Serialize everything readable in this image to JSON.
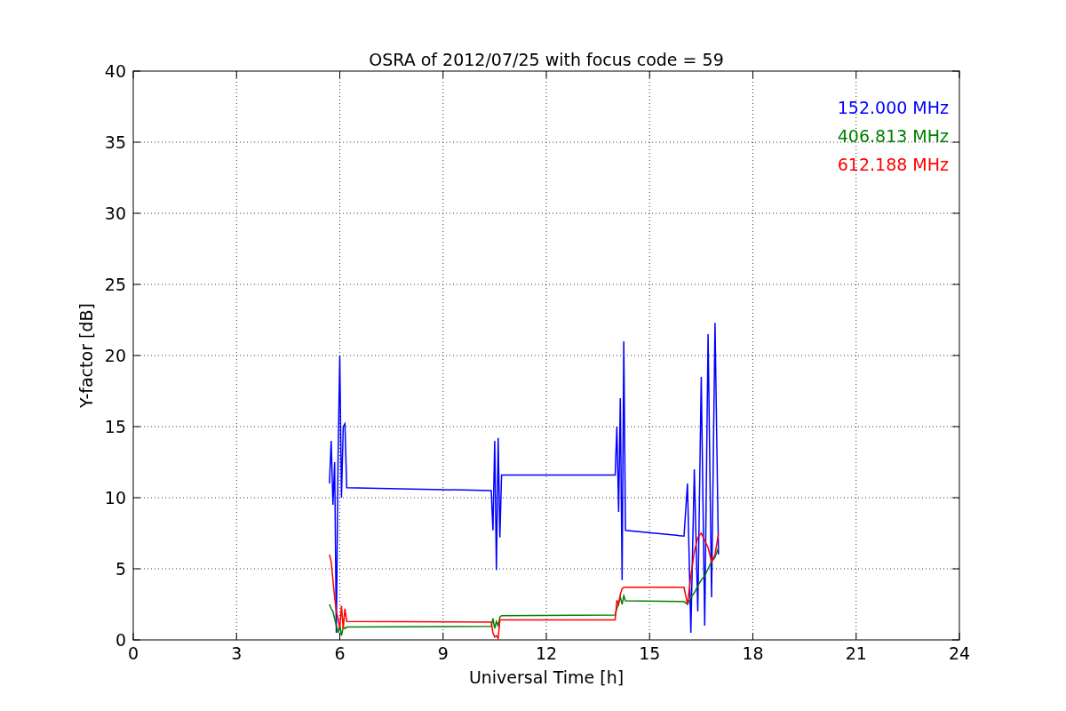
{
  "figure": {
    "chart_data": {
      "type": "line",
      "title": "OSRA of 2012/07/25 with focus code = 59",
      "xlabel": "Universal Time [h]",
      "ylabel": "Y-factor [dB]",
      "x": [
        5.7,
        5.75,
        5.8,
        5.85,
        5.9,
        5.95,
        6.0,
        6.05,
        6.1,
        6.15,
        6.2,
        10.4,
        10.45,
        10.5,
        10.55,
        10.6,
        10.65,
        10.7,
        14.0,
        14.05,
        14.1,
        14.15,
        14.2,
        14.25,
        14.3,
        16.0,
        16.1,
        16.2,
        16.3,
        16.4,
        16.5,
        16.6,
        16.7,
        16.8,
        16.9,
        17.0
      ],
      "series": [
        {
          "name": "152.000 MHz",
          "color": "#0000ff",
          "values": [
            11,
            14,
            9.5,
            12.5,
            0.5,
            13,
            20,
            10,
            15,
            15.2,
            10.7,
            10.5,
            7.7,
            14,
            4.9,
            14.2,
            7.2,
            11.6,
            11.6,
            15,
            9,
            17,
            4.2,
            21,
            7.7,
            7.3,
            11,
            0.5,
            12,
            2,
            18.5,
            1,
            21.5,
            3,
            22.3,
            6
          ]
        },
        {
          "name": "406.813 MHz",
          "color": "#008000",
          "values": [
            2.5,
            2.2,
            2.0,
            1.5,
            1.0,
            0.5,
            1.0,
            0.3,
            0.9,
            0.8,
            0.9,
            0.95,
            1.5,
            0.8,
            1.3,
            1.0,
            1.6,
            1.7,
            1.75,
            2.2,
            2.6,
            3.0,
            2.5,
            3.1,
            2.75,
            2.7,
            2.5,
            3.0,
            3.3,
            3.8,
            4.2,
            4.5,
            5.0,
            5.5,
            5.8,
            6.5
          ]
        },
        {
          "name": "612.188 MHz",
          "color": "#ff0000",
          "values": [
            6.0,
            5.5,
            4.2,
            3.0,
            2.0,
            1.5,
            0.8,
            2.4,
            0.8,
            2.2,
            1.3,
            1.25,
            0.5,
            0.2,
            0.3,
            0.1,
            1.4,
            1.4,
            1.4,
            2.8,
            2.5,
            3.2,
            3.6,
            3.7,
            3.7,
            3.7,
            2.5,
            4.5,
            6.2,
            7.2,
            7.5,
            7.0,
            6.5,
            5.5,
            6.0,
            7.5
          ]
        }
      ],
      "xlim": [
        0,
        24
      ],
      "ylim": [
        0,
        40
      ],
      "xticks": [
        0,
        3,
        6,
        9,
        12,
        15,
        18,
        21,
        24
      ],
      "yticks": [
        0,
        5,
        10,
        15,
        20,
        25,
        30,
        35,
        40
      ],
      "grid": true
    }
  }
}
